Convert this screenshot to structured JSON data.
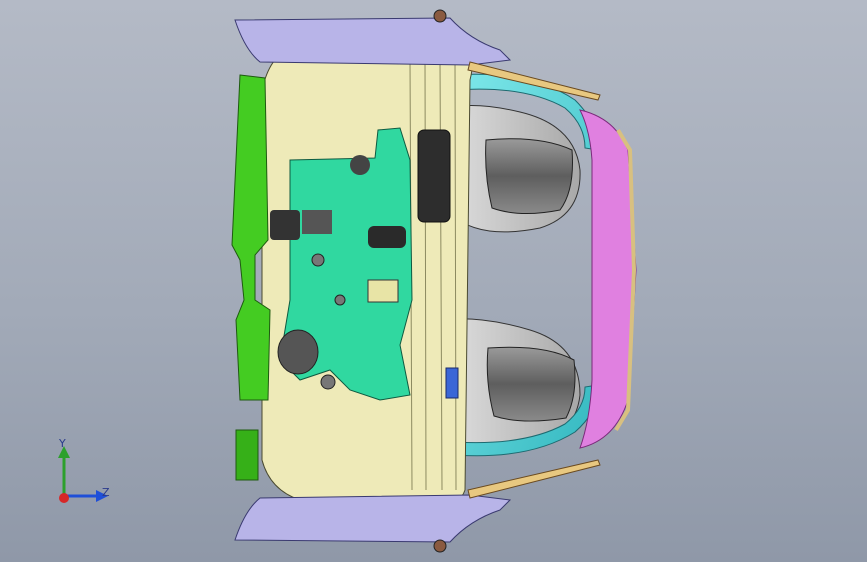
{
  "viewport": {
    "background_top": "#b4bac6",
    "background_bottom": "#8f98a8"
  },
  "model": {
    "part_colors": {
      "dash_panel": "#eeeab8",
      "center_bracket": "#30d8a0",
      "side_panel": "#44cc22",
      "cross_beam": "#50d4d8",
      "front_trim": "#e080e0",
      "top_brackets": "#b8b4e8",
      "seat_shells": "#7a7a7a"
    }
  },
  "triad": {
    "y_label": "Y",
    "z_label": "Z",
    "y_axis_color": "#2ca02c",
    "z_axis_color": "#1f4fd8",
    "x_axis_color": "#d62728"
  }
}
